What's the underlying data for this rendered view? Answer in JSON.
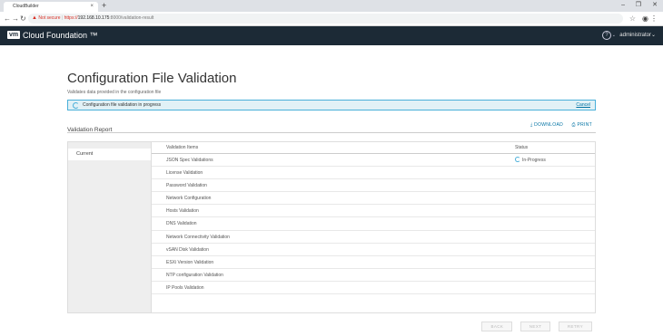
{
  "browser": {
    "tab_title": "CloudBuilder",
    "tab_close": "×",
    "new_tab": "+",
    "window_controls": [
      "–",
      "❐",
      "✕"
    ],
    "not_secure": "Not secure",
    "url_proto": "https://",
    "url_host": "192.168.10.175",
    "url_path": ":8000/validation-result"
  },
  "header": {
    "logo": "vm",
    "app_name": "Cloud Foundation ™",
    "user": "administrator"
  },
  "page": {
    "title": "Configuration File Validation",
    "subtitle": "Validates data provided in the configuration file",
    "alert_text": "Configuration file validation in progress",
    "alert_cancel": "Cancel",
    "report_title": "Validation Report",
    "download": "DOWNLOAD",
    "print": "PRINT",
    "nav_current": "Current"
  },
  "table": {
    "col_item": "Validation Items",
    "col_status": "Status",
    "rows": [
      {
        "name": "JSON Spec Validations",
        "status": "In-Progress"
      },
      {
        "name": "License Validation",
        "status": ""
      },
      {
        "name": "Password Validation",
        "status": ""
      },
      {
        "name": "Network Configuration",
        "status": ""
      },
      {
        "name": "Hosts Validation",
        "status": ""
      },
      {
        "name": "DNS Validation",
        "status": ""
      },
      {
        "name": "Network Connectivity Validation",
        "status": ""
      },
      {
        "name": "vSAN Disk Validation",
        "status": ""
      },
      {
        "name": "ESXi Version Validation",
        "status": ""
      },
      {
        "name": "NTP configuration Validation",
        "status": ""
      },
      {
        "name": "IP Pools Validation",
        "status": ""
      }
    ]
  },
  "footer": {
    "back": "BACK",
    "next": "NEXT",
    "retry": "RETRY"
  }
}
